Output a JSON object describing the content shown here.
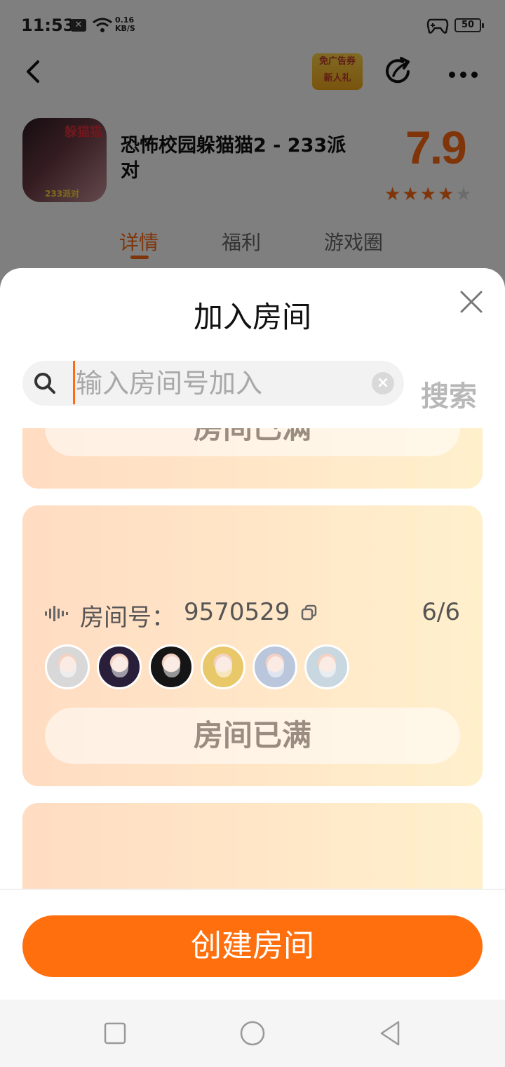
{
  "status_bar": {
    "time": "11:53",
    "notification": "✕",
    "net_speed_value": "0.16",
    "net_speed_unit": "KB/S",
    "battery": "50"
  },
  "header": {
    "ad_badge_line1": "免广告券",
    "ad_badge_line2": "新人礼"
  },
  "game": {
    "title": "恐怖校园躲猫猫2 - 233派对",
    "rating": "7.9",
    "stars_filled": 4,
    "stars_total": 5,
    "icon_text": "躲猫猫",
    "icon_subtext": "233派对"
  },
  "tabs": [
    {
      "label": "详情",
      "active": true
    },
    {
      "label": "福利",
      "active": false
    },
    {
      "label": "游戏圈",
      "active": false
    }
  ],
  "sheet": {
    "title": "加入房间",
    "search_placeholder": "输入房间号加入",
    "search_button": "搜索"
  },
  "rooms": [
    {
      "full_label": "房间已满"
    },
    {
      "room_label": "房间号：",
      "room_number": "9570529",
      "count": "6/6",
      "full_label": "房间已满",
      "avatar_colors": [
        "#d8d8d8",
        "#2a1f3a",
        "#151515",
        "#e9c86a",
        "#b9c6dc",
        "#c9d8e0"
      ]
    }
  ],
  "footer": {
    "create_button": "创建房间"
  },
  "colors": {
    "accent": "#ff6f0e",
    "rating": "#ff6a13"
  }
}
